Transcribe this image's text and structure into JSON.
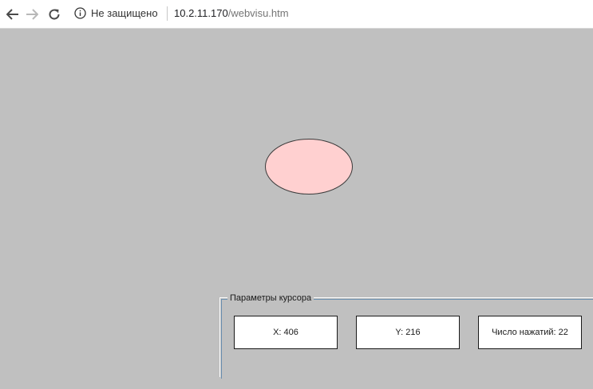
{
  "browser": {
    "security_label": "Не защищено",
    "url_host": "10.2.11.170",
    "url_path": "/webvisu.htm"
  },
  "visu": {
    "ellipse_color": "#ffd0d0",
    "cursor_group": {
      "title": "Параметры курсора",
      "x_label": "X: 406",
      "y_label": "Y: 216",
      "clicks_label": "Число нажатий: 22"
    }
  },
  "colors": {
    "background": "#c0c0c0",
    "ellipse_fill": "#ffd0d0"
  },
  "icons": [
    "back-arrow-icon",
    "forward-arrow-icon",
    "reload-icon",
    "info-icon"
  ]
}
